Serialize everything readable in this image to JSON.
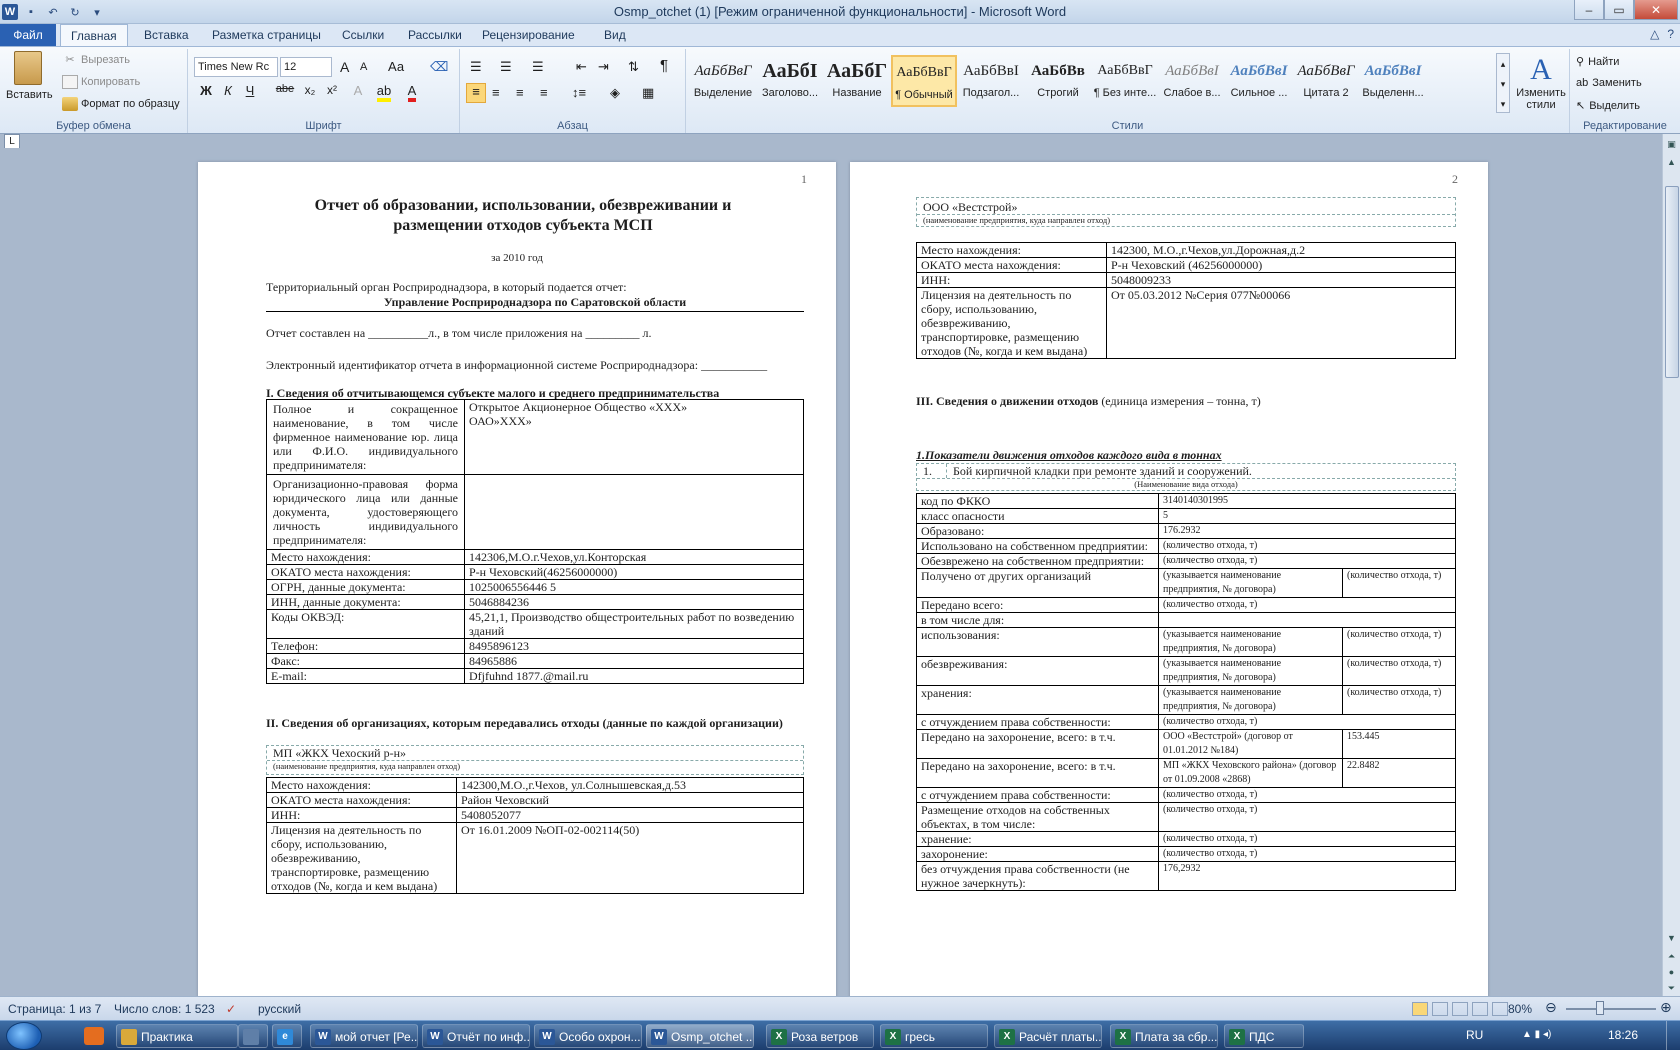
{
  "window": {
    "title": "Osmp_otchet (1) [Режим ограниченной функциональности]  -  Microsoft Word"
  },
  "tabs": [
    "Файл",
    "Главная",
    "Вставка",
    "Разметка страницы",
    "Ссылки",
    "Рассылки",
    "Рецензирование",
    "Вид"
  ],
  "ribbon": {
    "clipboard": {
      "paste": "Вставить",
      "cut": "Вырезать",
      "copy": "Копировать",
      "format_painter": "Формат по образцу",
      "label": "Буфер обмена"
    },
    "font": {
      "name": "Times New Rc",
      "size": "12",
      "label": "Шрифт",
      "case": "Аа",
      "bold": "Ж",
      "italic": "К",
      "underline": "Ч",
      "strike": "abe",
      "sub": "x₂",
      "sup": "x²",
      "grow": "A",
      "shrink": "A"
    },
    "paragraph": {
      "label": "Абзац",
      "pilcrow": "¶"
    },
    "styles": {
      "label": "Стили",
      "items": [
        {
          "preview": "АаБбВвГ",
          "name": "Выделение"
        },
        {
          "preview": "АаБбI",
          "name": "Заголово..."
        },
        {
          "preview": "АаБбГ",
          "name": "Название"
        },
        {
          "preview": "АаБбВвГ",
          "name": "¶ Обычный"
        },
        {
          "preview": "АаБбВвІ",
          "name": "Подзагол..."
        },
        {
          "preview": "АаБбВв",
          "name": "Строгий"
        },
        {
          "preview": "АаБбВвГ",
          "name": "¶ Без инте..."
        },
        {
          "preview": "АаБбВвІ",
          "name": "Слабое в..."
        },
        {
          "preview": "АаБбВвІ",
          "name": "Сильное ..."
        },
        {
          "preview": "АаБбВвГ",
          "name": "Цитата 2"
        },
        {
          "preview": "АаБбВвІ",
          "name": "Выделенн..."
        }
      ],
      "change": "Изменить стили",
      "change_icon_text": "A"
    },
    "editing": {
      "find": "Найти",
      "replace": "Заменить",
      "select": "Выделить",
      "label": "Редактирование"
    }
  },
  "page1": {
    "number": "1",
    "title": "Отчет об образовании, использовании, обезвреживании и размещении отходов субъекта МСП",
    "year": "за 2010 год",
    "authority_q": "Территориальный орган Росприроднадзора, в который подается отчет:",
    "authority": "Управление Росприроднадзора по Саратовской области",
    "compiled": "Отчет составлен на __________л., в том числе приложения на _________ л.",
    "eid": "Электронный идентификатор отчета в информационной системе Росприроднадзора: ___________",
    "sec1": "I. Сведения об отчитывающемся  субъекте  малого и среднего  предпринимательства",
    "sec1_rows": [
      {
        "k": "Полное и сокращенное наименование, в том числе фирменное наименование юр. лица или Ф.И.О. индивидуального предпринимателя:",
        "v": "Открытое Акционерное Общество «ХХХ»\nОАО»ХХХ»"
      },
      {
        "k": "Организационно-правовая форма юридического лица или данные документа, удостоверяющего личность индивидуального предпринимателя:",
        "v": ""
      },
      {
        "k": "Место нахождения:",
        "v": "142306,М.О.г.Чехов,ул.Конторская"
      },
      {
        "k": "ОКАТО места нахождения:",
        "v": "Р-н Чеховский(46256000000)"
      },
      {
        "k": "ОГРН, данные документа:",
        "v": "1025006556446 5"
      },
      {
        "k": "ИНН, данные документа:",
        "v": "5046884236"
      },
      {
        "k": "Коды ОКВЭД:",
        "v": "45,21,1, Производство общестроительных работ по возведению зданий"
      },
      {
        "k": "Телефон:",
        "v": "8495896123"
      },
      {
        "k": "Факс:",
        "v": "84965886"
      },
      {
        "k": "E-mail:",
        "v": "Dfjfuhnd 1877.@mail.ru"
      }
    ],
    "sec2": "II. Сведения об организациях, которым передавались отходы (данные по каждой организации)",
    "org_name": "МП «ЖКХ Чехоский р-н»",
    "org_caption": "(наименование  предприятия, куда направлен отход)",
    "org_rows": [
      {
        "k": "Место нахождения:",
        "v": "142300,М.О.,г.Чехов, ул.Солнышевская,д.53"
      },
      {
        "k": "ОКАТО места нахождения:",
        "v": "Район Чеховский"
      },
      {
        "k": "ИНН:",
        "v": "5408052077"
      },
      {
        "k": "Лицензия на деятельность по сбору, использованию, обезвреживанию, транспортировке, размещению отходов (№, когда и кем выдана)",
        "v": "От 16.01.2009 №ОП-02-002114(50)"
      }
    ]
  },
  "page2": {
    "number": "2",
    "org_name": "ООО «Вестстрой»",
    "org_caption": "(наименование  предприятия, куда направлен отход)",
    "org_rows": [
      {
        "k": "Место нахождения:",
        "v": "142300, М.О.,г.Чехов,ул.Дорожная,д.2"
      },
      {
        "k": "ОКАТО места нахождения:",
        "v": "Р-н Чеховский (46256000000)"
      },
      {
        "k": "ИНН:",
        "v": "5048009233"
      },
      {
        "k": "Лицензия на деятельность по сбору, использованию, обезвреживанию, транспортировке, размещению отходов (№, когда и кем выдана)",
        "v": "От 05.03.2012 №Серия 077№00066"
      }
    ],
    "sec3": "III. Сведения о движении отходов",
    "sec3_unit": " (единица  измерения  – тонна,  т)",
    "sub1": "1.Показатели движения отходов каждого вида в тоннах",
    "waste_num": "1.",
    "waste_name": "Бой кирпичной кладки при ремонте зданий и сооружений.",
    "waste_caption": "(Наименование  вида отхода)",
    "rows": [
      {
        "k": "код по ФККО",
        "a": "3140140301995",
        "b": null
      },
      {
        "k": "класс опасности",
        "a": "5",
        "b": null
      },
      {
        "k": "Образовано:",
        "a": "176.2932",
        "b": null
      },
      {
        "k": "Использовано на собственном предприятии:",
        "a": "(количество отхода, т)",
        "b": null
      },
      {
        "k": "Обезврежено на собственном предприятии:",
        "a": "(количество отхода, т)",
        "b": null
      },
      {
        "k": "Получено от других организаций",
        "a": "(указывается наименование предприятия, № договора)",
        "b": "(количество отхода, т)"
      },
      {
        "k": "Передано всего:",
        "a": "(количество отхода, т)",
        "b": null
      },
      {
        "k": "в том числе для:",
        "a": "",
        "b": null
      },
      {
        "k": "использования:",
        "a": "(указывается наименование предприятия, № договора)",
        "b": "(количество отхода, т)"
      },
      {
        "k": "обезвреживания:",
        "a": "(указывается наименование предприятия, № договора)",
        "b": "(количество отхода, т)"
      },
      {
        "k": "хранения:",
        "a": "(указывается наименование предприятия, № договора)",
        "b": "(количество отхода, т)"
      },
      {
        "k": "с отчуждением права собственности:",
        "a": "(количество отхода, т)",
        "b": null
      },
      {
        "k": "Передано на захоронение, всего: в т.ч.",
        "a": "ООО «Вестстрой» (договор от 01.01.2012 №184)",
        "b": "153.445"
      },
      {
        "k": "Передано на захоронение, всего: в т.ч.",
        "a": "МП «ЖКХ Чеховского района» (договор от 01.09.2008 «2868)",
        "b": "22.8482"
      },
      {
        "k": "с отчуждением права собственности:",
        "a": "(количество отхода, т)",
        "b": null
      },
      {
        "k": "Размещение отходов на собственных объектах, в том числе:",
        "a": "(количество отхода, т)",
        "b": null
      },
      {
        "k": "хранение:",
        "a": "(количество отхода, т)",
        "b": null
      },
      {
        "k": "захоронение:",
        "a": "(количество отхода, т)",
        "b": null
      },
      {
        "k": "без отчуждения права собственности (не нужное зачеркнуть):",
        "a": "176,2932",
        "b": null
      }
    ]
  },
  "status": {
    "page": "Страница: 1 из 7",
    "words": "Число слов: 1 523",
    "lang": "русский",
    "zoom": "80%"
  },
  "taskbar": {
    "items": [
      {
        "label": "Практика",
        "icon": "folder-icon",
        "color": "#d9a93a"
      },
      {
        "label": "",
        "icon": "notepad-icon",
        "color": "#5f7fa8"
      },
      {
        "label": "",
        "icon": "ie-icon",
        "color": "#2f89d8"
      },
      {
        "label": "мой отчет [Ре...",
        "icon": "word-icon",
        "color": "#2b5797"
      },
      {
        "label": "Отчёт по инф...",
        "icon": "word-icon",
        "color": "#2b5797"
      },
      {
        "label": "Особо охрон...",
        "icon": "word-icon",
        "color": "#2b5797"
      },
      {
        "label": "Osmp_otchet ...",
        "icon": "word-icon",
        "color": "#2b5797"
      },
      {
        "label": "Роза ветров",
        "icon": "excel-icon",
        "color": "#1e7145"
      },
      {
        "label": "гресь",
        "icon": "excel-icon",
        "color": "#1e7145"
      },
      {
        "label": "Расчёт платы...",
        "icon": "excel-icon",
        "color": "#1e7145"
      },
      {
        "label": "Плата за сбр...",
        "icon": "excel-icon",
        "color": "#1e7145"
      },
      {
        "label": "ПДС",
        "icon": "excel-icon",
        "color": "#1e7145"
      }
    ],
    "lang": "RU",
    "time": "18:26"
  },
  "colors": {
    "file_tab": "#2a61b3",
    "word_blue": "#2b5797",
    "excel_green": "#1e7145"
  }
}
